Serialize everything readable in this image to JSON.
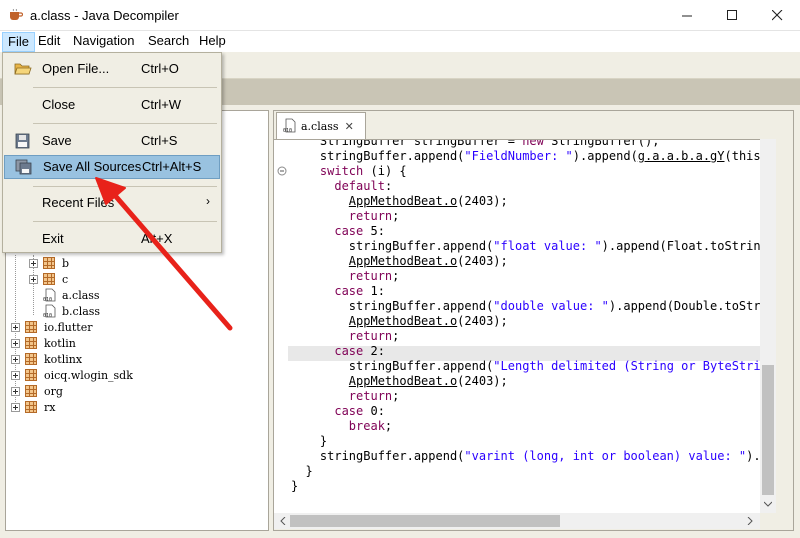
{
  "window": {
    "title": "a.class - Java Decompiler"
  },
  "menubar": [
    {
      "label": "File"
    },
    {
      "label": "Edit"
    },
    {
      "label": "Navigation"
    },
    {
      "label": "Search"
    },
    {
      "label": "Help"
    }
  ],
  "file_menu": {
    "open": {
      "label": "Open File...",
      "shortcut": "Ctrl+O"
    },
    "close": {
      "label": "Close",
      "shortcut": "Ctrl+W"
    },
    "save": {
      "label": "Save",
      "shortcut": "Ctrl+S"
    },
    "save_all": {
      "label": "Save All Sources",
      "shortcut": "Ctrl+Alt+S"
    },
    "recent": {
      "label": "Recent Files"
    },
    "exit": {
      "label": "Exit",
      "shortcut": "Alt+X"
    }
  },
  "tree": {
    "sub_items": [
      "b",
      "c",
      "a.class",
      "b.class"
    ],
    "packages": [
      "io.flutter",
      "kotlin",
      "kotlinx",
      "oicq.wlogin_sdk",
      "org",
      "rx"
    ]
  },
  "editor": {
    "tab_label": "a.class",
    "lines": [
      "    StringBuffer stringBuffer = new StringBuffer();",
      "    stringBuffer.append(\"FieldNumber: \").append(g.a.a.b.a.gY(this.U",
      "    switch (i) {",
      "      default:",
      "        AppMethodBeat.o(2403);",
      "        return;",
      "      case 5:",
      "        stringBuffer.append(\"float value: \").append(Float.toString(",
      "        AppMethodBeat.o(2403);",
      "        return;",
      "      case 1:",
      "        stringBuffer.append(\"double value: \").append(Double.toStrin",
      "        AppMethodBeat.o(2403);",
      "        return;",
      "      case 2:",
      "        stringBuffer.append(\"Length delimited (String or ByteString",
      "        AppMethodBeat.o(2403);",
      "        return;",
      "      case 0:",
      "        break;",
      "    }",
      "    stringBuffer.append(\"varint (long, int or boolean) value: \").ap",
      "  }",
      "}"
    ]
  },
  "colors": {
    "keyword": "#7f0055",
    "string": "#2a00ff",
    "menu_highlight": "#99c2e0",
    "annotation_arrow": "#e8221a"
  }
}
